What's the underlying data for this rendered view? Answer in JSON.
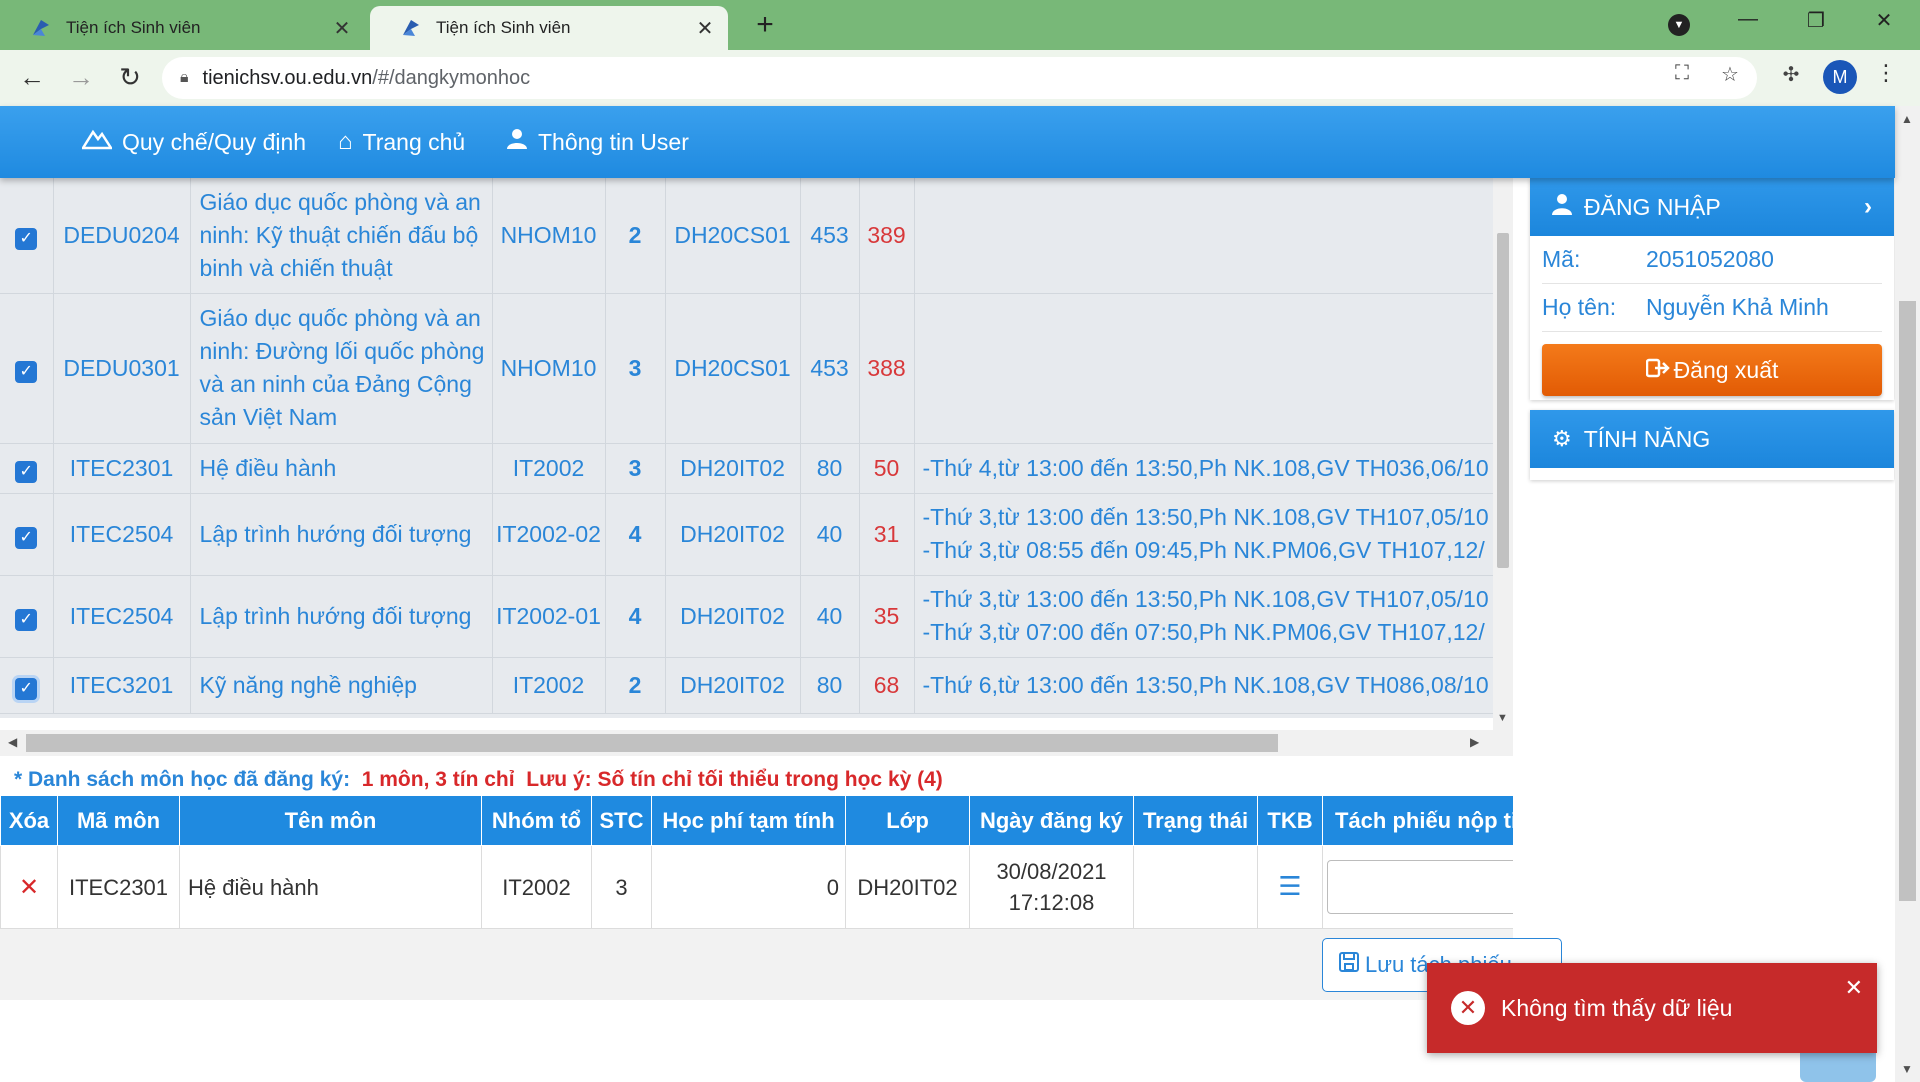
{
  "browser": {
    "tabs": [
      {
        "title": "Tiện ích Sinh viên",
        "active": false
      },
      {
        "title": "Tiện ích Sinh viên",
        "active": true
      }
    ],
    "url_host": "tienichsv.ou.edu.vn",
    "url_path": "/#/dangkymonhoc",
    "profile_initial": "M"
  },
  "header": {
    "nav": [
      {
        "label": "Quy chế/Quy định",
        "icon": "mountain-icon"
      },
      {
        "label": "Trang chủ",
        "icon": "home-icon"
      },
      {
        "label": "Thông tin User",
        "icon": "user-icon"
      }
    ]
  },
  "courses": [
    {
      "code": "DEDU0204",
      "name": "Giáo dục quốc phòng và an ninh: Kỹ thuật chiến đấu bộ binh và chiến thuật",
      "group": "NHOM10",
      "credits": "2",
      "class": "DH20CS01",
      "capacity": "453",
      "remaining": "389",
      "schedule": ""
    },
    {
      "code": "DEDU0301",
      "name": "Giáo dục quốc phòng và an ninh: Đường lối quốc phòng và an ninh của Đảng Cộng sản Việt Nam",
      "group": "NHOM10",
      "credits": "3",
      "class": "DH20CS01",
      "capacity": "453",
      "remaining": "388",
      "schedule": ""
    },
    {
      "code": "ITEC2301",
      "name": "Hệ điều hành",
      "group": "IT2002",
      "credits": "3",
      "class": "DH20IT02",
      "capacity": "80",
      "remaining": "50",
      "schedule": "-Thứ 4,từ 13:00 đến 13:50,Ph NK.108,GV TH036,06/10"
    },
    {
      "code": "ITEC2504",
      "name": "Lập trình hướng đối tượng",
      "group": "IT2002-02",
      "credits": "4",
      "class": "DH20IT02",
      "capacity": "40",
      "remaining": "31",
      "schedule": "-Thứ 3,từ 13:00 đến 13:50,Ph NK.108,GV TH107,05/10",
      "schedule2": "-Thứ 3,từ 08:55 đến 09:45,Ph NK.PM06,GV TH107,12/"
    },
    {
      "code": "ITEC2504",
      "name": "Lập trình hướng đối tượng",
      "group": "IT2002-01",
      "credits": "4",
      "class": "DH20IT02",
      "capacity": "40",
      "remaining": "35",
      "schedule": "-Thứ 3,từ 13:00 đến 13:50,Ph NK.108,GV TH107,05/10",
      "schedule2": "-Thứ 3,từ 07:00 đến 07:50,Ph NK.PM06,GV TH107,12/"
    },
    {
      "code": "ITEC3201",
      "name": "Kỹ năng nghề nghiệp",
      "group": "IT2002",
      "credits": "2",
      "class": "DH20IT02",
      "capacity": "80",
      "remaining": "68",
      "schedule": "-Thứ 6,từ 13:00 đến 13:50,Ph NK.108,GV TH086,08/10"
    }
  ],
  "registered": {
    "title_prefix": "* Danh sách môn học đã đăng ký:",
    "title_count": "1 môn, 3 tín chỉ",
    "title_note": "Lưu ý: Số tín chỉ tối thiểu trong học kỳ (4)",
    "columns": [
      "Xóa",
      "Mã môn",
      "Tên môn",
      "Nhóm tổ",
      "STC",
      "Học phí tạm tính",
      "Lớp",
      "Ngày đăng ký",
      "Trạng thái",
      "TKB",
      "Tách phiếu nộp tiền"
    ],
    "rows": [
      {
        "code": "ITEC2301",
        "name": "Hệ điều hành",
        "group": "IT2002",
        "credits": "3",
        "fee": "0",
        "class": "DH20IT02",
        "date": "30/08/2021",
        "time": "17:12:08",
        "status": ""
      }
    ],
    "save_label": "Lưu tách phiếu"
  },
  "login": {
    "title": "ĐĂNG NHẬP",
    "id_label": "Mã:",
    "id_value": "2051052080",
    "name_label": "Họ tên:",
    "name_value": "Nguyễn Khả Minh",
    "logout_label": "Đăng xuất"
  },
  "features": {
    "title": "TÍNH NĂNG"
  },
  "toast": {
    "message": "Không tìm thấy dữ liệu"
  },
  "colors": {
    "header": "#1f8ae0",
    "accent": "#2a86d8",
    "danger": "#c62a2a",
    "logout": "#e25b04",
    "tabstrip": "#78b878"
  }
}
